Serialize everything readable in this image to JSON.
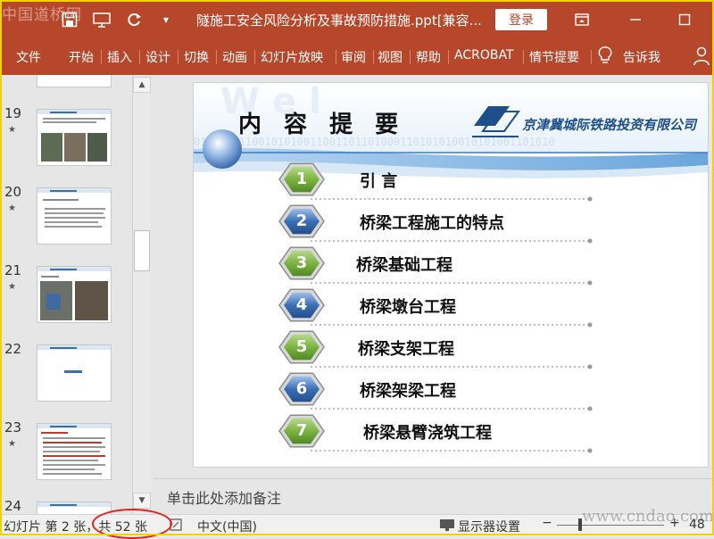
{
  "titlebar": {
    "watermark": "中国道桥网",
    "title": "隧施工安全风险分析及事故预防措施.ppt[兼容...",
    "login": "登录",
    "qa_dropdown": "▾"
  },
  "ribbon": {
    "tabs": [
      "文件",
      "开始",
      "插入",
      "设计",
      "切换",
      "动画",
      "幻灯片放映",
      "审阅",
      "视图",
      "帮助",
      "ACROBAT",
      "情节提要"
    ],
    "tell_me": "告诉我"
  },
  "thumbnails": [
    {
      "num": "19",
      "star": "★"
    },
    {
      "num": "20",
      "star": "★"
    },
    {
      "num": "21",
      "star": "★"
    },
    {
      "num": "22",
      "star": ""
    },
    {
      "num": "23",
      "star": "★"
    },
    {
      "num": "24",
      "star": ""
    }
  ],
  "slide": {
    "title": "内 容 提 要",
    "company": "京津冀城际铁路投资有限公司",
    "items": [
      {
        "num": "1",
        "label": "引  言",
        "color": "green"
      },
      {
        "num": "2",
        "label": "桥梁工程施工的特点",
        "color": "blue"
      },
      {
        "num": "3",
        "label": "桥梁基础工程",
        "color": "green"
      },
      {
        "num": "4",
        "label": "桥梁墩台工程",
        "color": "blue"
      },
      {
        "num": "5",
        "label": "桥梁支架工程",
        "color": "green"
      },
      {
        "num": "6",
        "label": "桥梁架梁工程",
        "color": "blue"
      },
      {
        "num": "7",
        "label": "桥梁悬臂浇筑工程",
        "color": "green"
      }
    ]
  },
  "notes": {
    "placeholder": "单击此处添加备注"
  },
  "status": {
    "slide_info": "幻灯片 第 2 张，共 52 张",
    "language": "中文(中国)",
    "display_settings": "显示器设置",
    "zoom": "48",
    "watermark": "www.cndao.com"
  },
  "colors": {
    "accent": "#b7472a",
    "green_node": "#7cb342",
    "blue_node": "#3b6fb5",
    "highlight_oval": "#e0201a"
  }
}
